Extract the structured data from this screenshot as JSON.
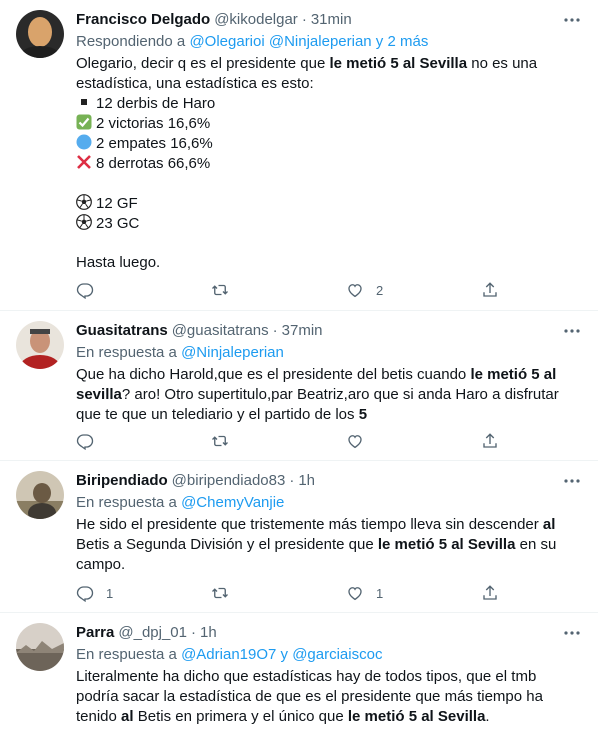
{
  "tweets": [
    {
      "name": "Francisco Delgado",
      "handle": "@kikodelgar",
      "time": "31min",
      "reply_prefix": "Respondiendo a",
      "reply_mentions": "@Olegarioi @Ninjaleperian y 2 más",
      "body_intro": "Olegario, decir q es el presidente que ",
      "body_bold": "le metió 5 al Sevilla",
      "body_rest": " no es una estadística, una estadística es esto:",
      "stats": [
        {
          "icon": "square-bullet-icon",
          "text": "12 derbis de Haro"
        },
        {
          "icon": "check-mark-icon",
          "text": "2 victorias 16,6%"
        },
        {
          "icon": "blue-circle-icon",
          "text": "2 empates 16,6%"
        },
        {
          "icon": "cross-mark-icon",
          "text": "8 derrotas 66,6%"
        }
      ],
      "goals": [
        {
          "icon": "soccer-ball-icon",
          "text": "12 GF"
        },
        {
          "icon": "soccer-ball-icon",
          "text": "23 GC"
        }
      ],
      "sign_off": "Hasta luego.",
      "reply_count": "",
      "retweet_count": "",
      "like_count": "2"
    },
    {
      "name": "Guasitatrans",
      "handle": "@guasitatrans",
      "time": "37min",
      "reply_prefix": "En respuesta a",
      "reply_mentions": "@Ninjaleperian",
      "parts": [
        {
          "t": "Que ha dicho Harold,que es el presidente del betis cuando ",
          "b": false
        },
        {
          "t": "le metió 5 al sevilla",
          "b": true
        },
        {
          "t": "? aro! Otro supertitulo,par Beatriz,aro que si anda Haro a disfrutar que te que un telediario y el partido de los ",
          "b": false
        },
        {
          "t": "5",
          "b": true
        }
      ],
      "reply_count": "",
      "retweet_count": "",
      "like_count": ""
    },
    {
      "name": "Biripendiado",
      "handle": "@biripendiado83",
      "time": "1h",
      "reply_prefix": "En respuesta a",
      "reply_mentions": "@ChemyVanjie",
      "parts": [
        {
          "t": "He sido el presidente que tristemente más tiempo lleva sin descender ",
          "b": false
        },
        {
          "t": "al",
          "b": true
        },
        {
          "t": " Betis a Segunda División y el presidente que ",
          "b": false
        },
        {
          "t": "le metió 5 al Sevilla",
          "b": true
        },
        {
          "t": " en su campo.",
          "b": false
        }
      ],
      "reply_count": "1",
      "retweet_count": "",
      "like_count": "1"
    },
    {
      "name": "Parra",
      "handle": "@_dpj_01",
      "time": "1h",
      "reply_prefix": "En respuesta a",
      "reply_mentions": "@Adrian19O7 y @garciaiscoc",
      "parts": [
        {
          "t": "Literalmente ha dicho que estadísticas hay de todos tipos, que el tmb podría sacar la estadística de que es el presidente que más tiempo ha tenido ",
          "b": false
        },
        {
          "t": "al",
          "b": true
        },
        {
          "t": " Betis en primera y el único que ",
          "b": false
        },
        {
          "t": "le metió 5 al Sevilla",
          "b": true
        },
        {
          "t": ".",
          "b": false
        }
      ]
    }
  ]
}
